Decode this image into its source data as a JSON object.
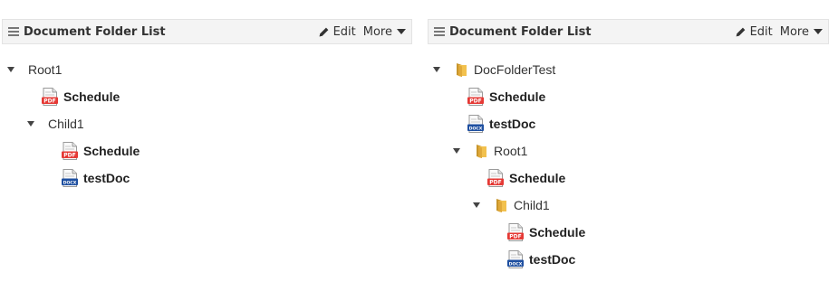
{
  "left_panel": {
    "title": "Document Folder List",
    "edit_label": "Edit",
    "more_label": "More",
    "tree": {
      "root": "Root1",
      "root_doc_1": "Schedule",
      "child": "Child1",
      "child_doc_1": "Schedule",
      "child_doc_2": "testDoc"
    }
  },
  "right_panel": {
    "title": "Document Folder List",
    "edit_label": "Edit",
    "more_label": "More",
    "tree": {
      "top": "DocFolderTest",
      "top_doc_1": "Schedule",
      "top_doc_2": "testDoc",
      "root": "Root1",
      "root_doc_1": "Schedule",
      "child": "Child1",
      "child_doc_1": "Schedule",
      "child_doc_2": "testDoc"
    }
  },
  "icon_text": {
    "pdf": "PDF",
    "doc": "DOCX"
  },
  "colors": {
    "pdf": "#e53935",
    "doc": "#1e4fa0",
    "folder": "#f2c14e"
  }
}
